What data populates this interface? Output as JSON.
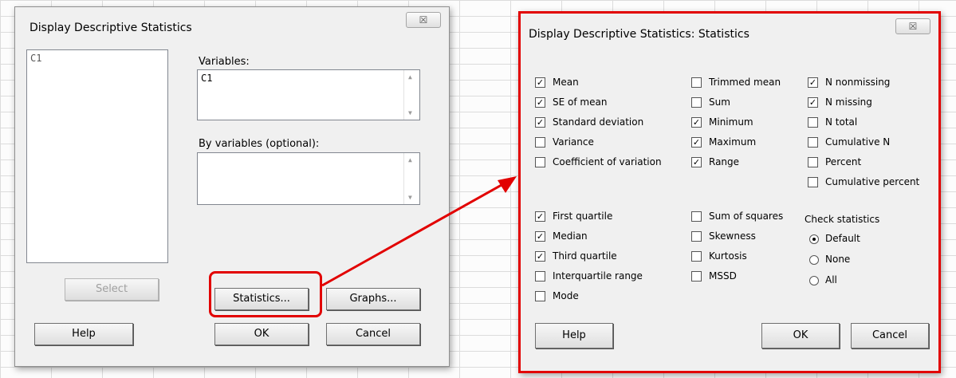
{
  "colors": {
    "accent_red": "#e20000",
    "dialog_bg": "#f0f0f0"
  },
  "main_dialog": {
    "title": "Display Descriptive Statistics",
    "close_glyph": "☒",
    "column_list": [
      "C1"
    ],
    "variables_label": "Variables:",
    "variables_value": "C1",
    "by_variables_label": "By variables (optional):",
    "by_variables_value": "",
    "buttons": {
      "select": "Select",
      "statistics": "Statistics...",
      "graphs": "Graphs...",
      "help": "Help",
      "ok": "OK",
      "cancel": "Cancel"
    }
  },
  "stats_dialog": {
    "title": "Display Descriptive Statistics: Statistics",
    "close_glyph": "☒",
    "checkboxes": {
      "mean": {
        "label": "Mean",
        "checked": true
      },
      "se_of_mean": {
        "label": "SE of mean",
        "checked": true
      },
      "standard_deviation": {
        "label": "Standard deviation",
        "checked": true
      },
      "variance": {
        "label": "Variance",
        "checked": false
      },
      "coefficient_of_variation": {
        "label": "Coefficient of variation",
        "checked": false
      },
      "trimmed_mean": {
        "label": "Trimmed mean",
        "checked": false
      },
      "sum": {
        "label": "Sum",
        "checked": false
      },
      "minimum": {
        "label": "Minimum",
        "checked": true
      },
      "maximum": {
        "label": "Maximum",
        "checked": true
      },
      "range": {
        "label": "Range",
        "checked": true
      },
      "n_nonmissing": {
        "label": "N nonmissing",
        "checked": true
      },
      "n_missing": {
        "label": "N missing",
        "checked": true
      },
      "n_total": {
        "label": "N total",
        "checked": false
      },
      "cumulative_n": {
        "label": "Cumulative N",
        "checked": false
      },
      "percent": {
        "label": "Percent",
        "checked": false
      },
      "cumulative_percent": {
        "label": "Cumulative percent",
        "checked": false
      },
      "first_quartile": {
        "label": "First quartile",
        "checked": true
      },
      "median": {
        "label": "Median",
        "checked": true
      },
      "third_quartile": {
        "label": "Third quartile",
        "checked": true
      },
      "interquartile_range": {
        "label": "Interquartile range",
        "checked": false
      },
      "mode": {
        "label": "Mode",
        "checked": false
      },
      "sum_of_squares": {
        "label": "Sum of squares",
        "checked": false
      },
      "skewness": {
        "label": "Skewness",
        "checked": false
      },
      "kurtosis": {
        "label": "Kurtosis",
        "checked": false
      },
      "mssd": {
        "label": "MSSD",
        "checked": false
      }
    },
    "check_statistics": {
      "label": "Check statistics",
      "options": {
        "default": {
          "label": "Default",
          "selected": true
        },
        "none": {
          "label": "None",
          "selected": false
        },
        "all": {
          "label": "All",
          "selected": false
        }
      }
    },
    "buttons": {
      "help": "Help",
      "ok": "OK",
      "cancel": "Cancel"
    }
  }
}
